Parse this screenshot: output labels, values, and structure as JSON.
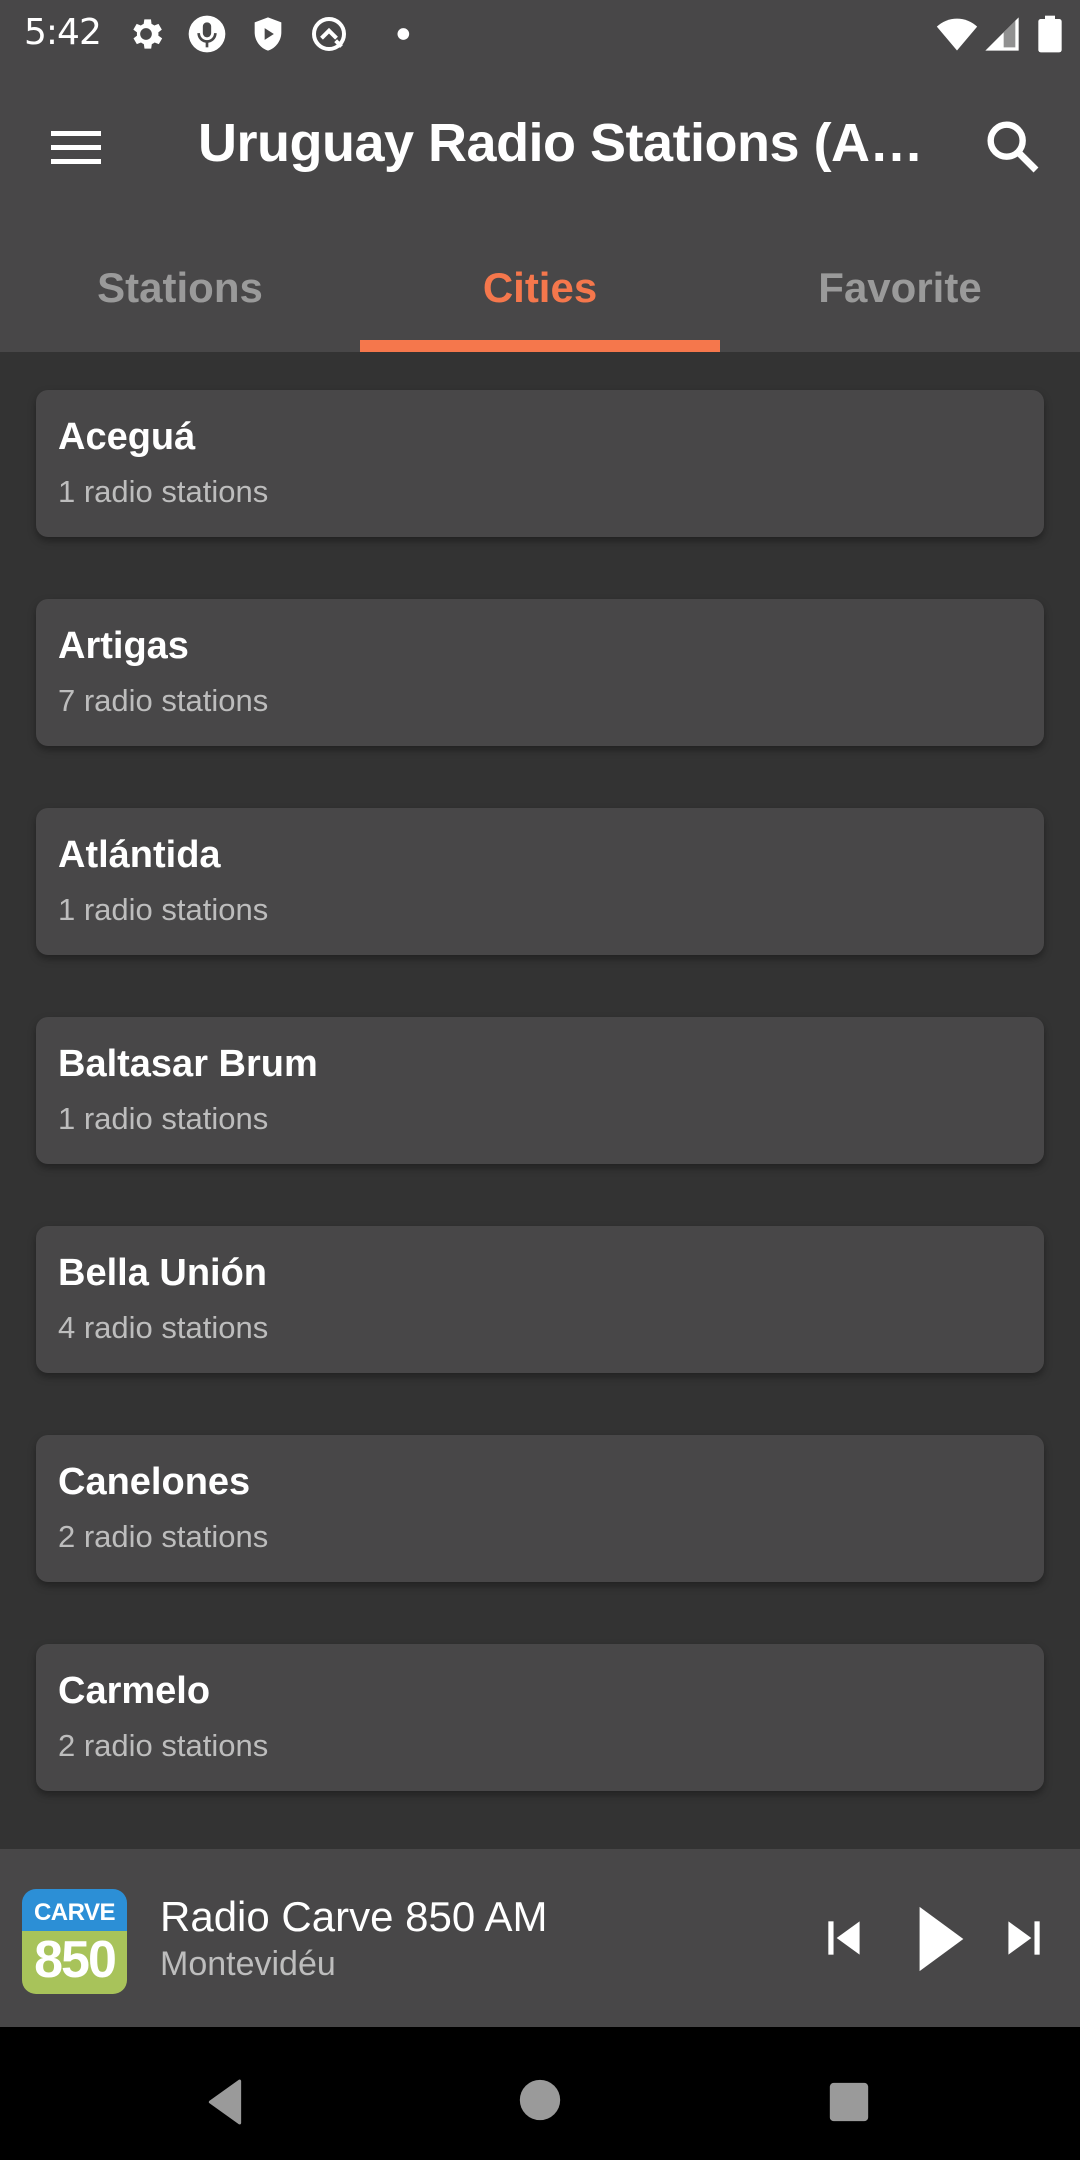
{
  "status_bar": {
    "time": "5:42",
    "left_icons": [
      "settings-icon",
      "mic-icon",
      "shield-play-icon",
      "q-logo-icon",
      "dot-icon"
    ],
    "right_icons": [
      "wifi-icon",
      "signal-icon",
      "battery-icon"
    ]
  },
  "app_bar": {
    "title": "Uruguay Radio Stations (A…",
    "menu_icon": "hamburger-menu-icon",
    "search_icon": "search-icon"
  },
  "tabs": [
    {
      "label": "Stations",
      "active": false
    },
    {
      "label": "Cities",
      "active": true
    },
    {
      "label": "Favorite",
      "active": false
    }
  ],
  "colors": {
    "accent": "#f5774c",
    "bar_bg": "#484748",
    "content_bg": "#333333",
    "card_bg": "#484748"
  },
  "cities": [
    {
      "name": "Aceguá",
      "count": "1 radio stations"
    },
    {
      "name": "Artigas",
      "count": "7 radio stations"
    },
    {
      "name": "Atlántida",
      "count": "1 radio stations"
    },
    {
      "name": "Baltasar Brum",
      "count": "1 radio stations"
    },
    {
      "name": "Bella Unión",
      "count": "4 radio stations"
    },
    {
      "name": "Canelones",
      "count": "2 radio stations"
    },
    {
      "name": "Carmelo",
      "count": "2 radio stations"
    }
  ],
  "player": {
    "logo_top": "CARVE",
    "logo_bottom": "850",
    "station": "Radio Carve 850 AM",
    "city": "Montevidéu",
    "controls": [
      "skip-previous-icon",
      "play-icon",
      "skip-next-icon"
    ]
  },
  "nav_bar": {
    "buttons": [
      "back-icon",
      "home-icon",
      "recents-icon"
    ]
  }
}
